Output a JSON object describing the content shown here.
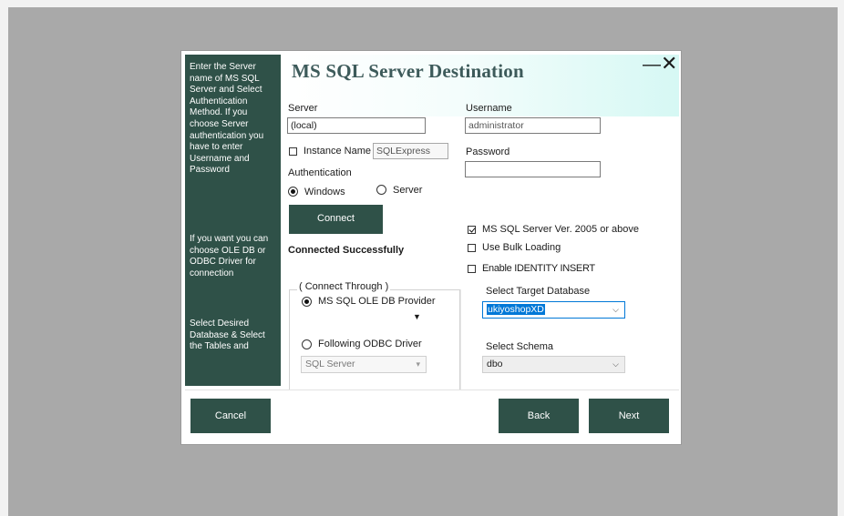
{
  "sidebar": {
    "text1": "Enter the Server name of MS SQL Server and Select Authentication Method. If you choose Server authentication you have to enter Username and Password",
    "text2": "If you want you can choose OLE DB or ODBC Driver for connection",
    "text3": "Select Desired Database & Select the Tables and"
  },
  "dialog": {
    "title": "MS SQL Server Destination",
    "minimize": "—",
    "close": "✕"
  },
  "server": {
    "label": "Server",
    "value": "(local)"
  },
  "instance": {
    "label": "Instance Name",
    "value": "SQLExpress",
    "checked": false
  },
  "auth": {
    "label": "Authentication",
    "windows_label": "Windows",
    "server_label": "Server",
    "selected": "Windows"
  },
  "connect": {
    "label": "Connect",
    "status": "Connected Successfully"
  },
  "username": {
    "label": "Username",
    "value": "administrator"
  },
  "password": {
    "label": "Password",
    "value": ""
  },
  "options": {
    "ver2005_label": "MS SQL Server Ver. 2005 or above",
    "ver2005_checked": true,
    "bulk_label": "Use Bulk Loading",
    "bulk_checked": false,
    "identity_label": "Enable IDENTITY INSERT",
    "identity_checked": false
  },
  "connect_through": {
    "legend": "( Connect Through )",
    "oledb_label": "MS SQL OLE DB Provider",
    "odbc_label": "Following ODBC Driver",
    "selected": "MS SQL OLE DB Provider",
    "odbc_driver": "SQL Server"
  },
  "target_db": {
    "label": "Select Target  Database",
    "value": "ukiyoshopXD"
  },
  "schema": {
    "label": "Select Schema",
    "value": "dbo"
  },
  "footer": {
    "cancel": "Cancel",
    "back": "Back",
    "next": "Next"
  }
}
